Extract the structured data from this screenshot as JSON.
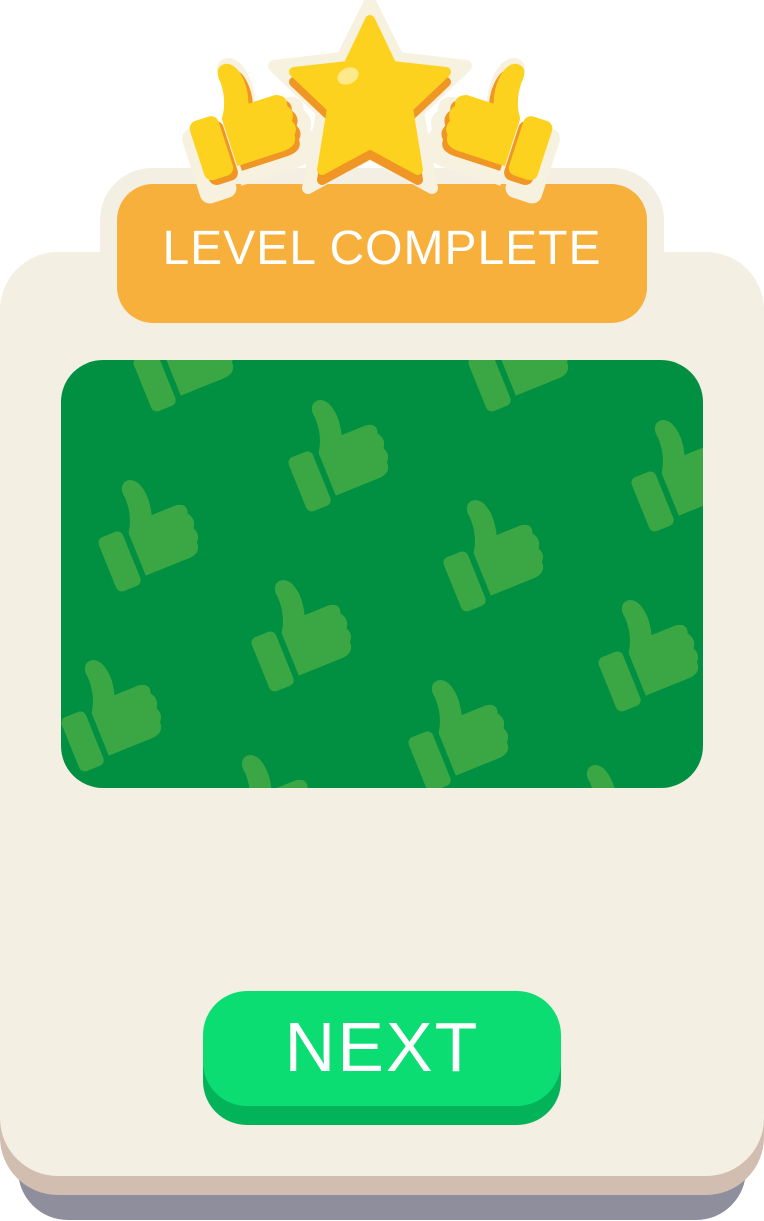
{
  "banner": {
    "title": "LEVEL COMPLETE"
  },
  "rating": {
    "stars": 1,
    "icons": [
      "thumbs-up-icon",
      "star-icon",
      "thumbs-up-icon"
    ]
  },
  "panel": {
    "pattern_icon": "thumbs-up-icon"
  },
  "actions": {
    "next_label": "NEXT"
  },
  "colors": {
    "card": "#f3efe3",
    "banner": "#f8b03d",
    "panel": "#019042",
    "pattern": "#3ba744",
    "button": "#0cdd73",
    "star": "#fdd21f"
  }
}
